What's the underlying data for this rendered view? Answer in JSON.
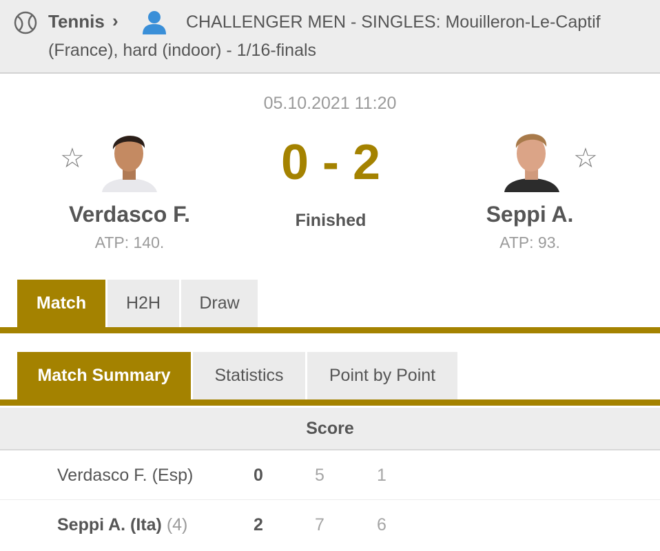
{
  "header": {
    "sport": "Tennis",
    "separator": "›",
    "tournament": "CHALLENGER MEN - SINGLES: Mouilleron-Le-Captif (France), hard (indoor) - 1/16-finals",
    "icons": [
      "tennis-ball-icon",
      "chevron-right-icon",
      "person-icon"
    ]
  },
  "match": {
    "datetime": "05.10.2021 11:20",
    "score": "0 - 2",
    "status": "Finished",
    "home": {
      "name": "Verdasco F.",
      "rank": "ATP: 140."
    },
    "away": {
      "name": "Seppi A.",
      "rank": "ATP: 93."
    },
    "star": "☆"
  },
  "tabs": [
    "Match",
    "H2H",
    "Draw"
  ],
  "subtabs": [
    "Match Summary",
    "Statistics",
    "Point by Point"
  ],
  "score_table": {
    "header": "Score",
    "rows": [
      {
        "name": "Verdasco F. (Esp)",
        "seed": "",
        "total": "0",
        "sets": [
          "5",
          "1"
        ]
      },
      {
        "name": "Seppi A. (Ita)",
        "seed": "(4)",
        "total": "2",
        "sets": [
          "7",
          "6"
        ]
      }
    ]
  },
  "colors": {
    "accent": "#a48200",
    "header_bg": "#ededed",
    "muted": "#9a9a9a"
  }
}
